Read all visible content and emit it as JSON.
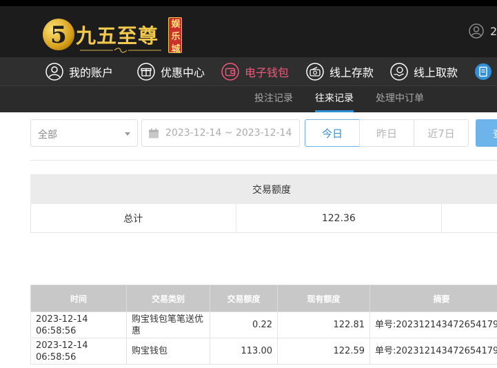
{
  "header": {
    "logo_numeral": "5",
    "logo_text": "九五至尊",
    "logo_badge": [
      "娱",
      "乐",
      "城"
    ],
    "user_text": "2"
  },
  "nav": {
    "items": [
      {
        "label": "我的账户",
        "icon": "user-circle-icon"
      },
      {
        "label": "优惠中心",
        "icon": "gift-icon"
      },
      {
        "label": "电子钱包",
        "icon": "wallet-icon",
        "active": true
      },
      {
        "label": "线上存款",
        "icon": "deposit-icon"
      },
      {
        "label": "线上取款",
        "icon": "withdraw-icon"
      }
    ]
  },
  "subnav": {
    "items": [
      {
        "label": "投注记录"
      },
      {
        "label": "往来记录",
        "active": true
      },
      {
        "label": "处理中订单"
      }
    ]
  },
  "filters": {
    "category": "全部",
    "date_range": "2023-12-14 ~ 2023-12-14",
    "today": "今日",
    "yesterday": "昨日",
    "last7": "近7日",
    "query": "查"
  },
  "summary": {
    "header": "交易额度",
    "row_label": "总计",
    "total": "122.36"
  },
  "records": {
    "columns": [
      "时间",
      "交易类别",
      "交易额度",
      "现有额度",
      "摘要"
    ],
    "rows": [
      {
        "time": "2023-12-14 06:58:56",
        "type": "购宝钱包笔笔送优惠",
        "amount": "0.22",
        "balance": "122.81",
        "memo": "单号:202312143472654179"
      },
      {
        "time": "2023-12-14 06:58:56",
        "type": "购宝钱包",
        "amount": "113.00",
        "balance": "122.59",
        "memo": "单号:202312143472654179"
      }
    ]
  },
  "colors": {
    "header_bg": "#1c1c1c",
    "nav_bg": "#2f2f2f",
    "active_nav": "#ef5a7a",
    "accent": "#2f8fd8",
    "logo_gold": "#f2c94c"
  }
}
